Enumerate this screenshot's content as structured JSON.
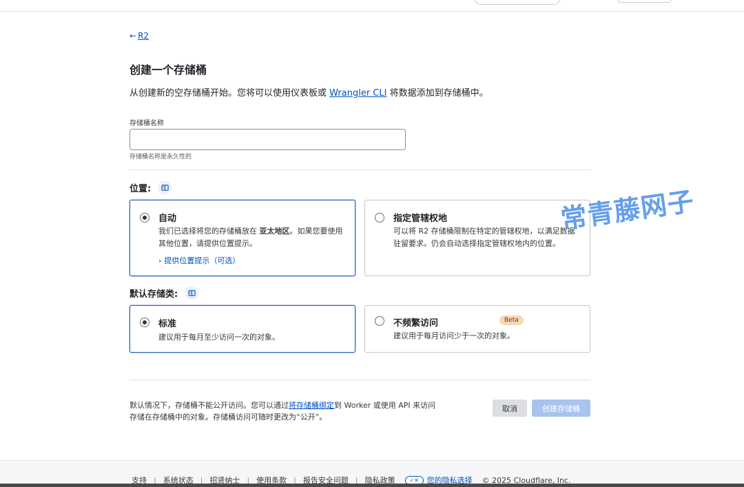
{
  "back": {
    "arrow": "←",
    "label": "R2"
  },
  "page": {
    "title": "创建一个存储桶",
    "intro_before": "从创建新的空存储桶开始。您将可以使用仪表板或 ",
    "intro_link": "Wrangler CLI",
    "intro_after": " 将数据添加到存储桶中。"
  },
  "bucket_name": {
    "label": "存储桶名称",
    "value": "",
    "placeholder": "",
    "help": "存储桶名称是永久性的"
  },
  "location": {
    "label": "位置:",
    "options": [
      {
        "title": "自动",
        "desc_before": "我们已选择将您的存储桶放在 ",
        "desc_bold": "亚太地区",
        "desc_after": "。如果您要使用其他位置，请提供位置提示。",
        "link": "提供位置提示（可选）",
        "selected": true
      },
      {
        "title": "指定管辖权地",
        "desc": "可以将 R2 存储桶限制在特定的管辖权地，以满足数据驻留要求。仍会自动选择指定管辖权地内的位置。",
        "selected": false
      }
    ]
  },
  "storage_class": {
    "label": "默认存储类:",
    "options": [
      {
        "title": "标准",
        "desc": "建议用于每月至少访问一次的对象。",
        "selected": true
      },
      {
        "title": "不频繁访问",
        "badge": "Beta",
        "desc": "建议用于每月访问少于一次的对象。",
        "selected": false
      }
    ]
  },
  "note": {
    "before": "默认情况下，存储桶不能公开访问。您可以通过",
    "link": "将存储桶绑定",
    "after": "到 Worker 或使用 API 来访问存储在存储桶中的对象。存储桶访问可随时更改为“公开”。"
  },
  "actions": {
    "cancel": "取消",
    "create": "创建存储桶"
  },
  "footer": {
    "links": [
      "支持",
      "系统状态",
      "招贤纳士",
      "使用条款",
      "报告安全问题",
      "隐私政策"
    ],
    "privacy_choice": "您的隐私选择",
    "copyright": "© 2025 Cloudflare, Inc."
  },
  "watermark": "常青藤网子",
  "colors": {
    "accent": "#0051c3",
    "selected_border": "#1f5fbf",
    "create_disabled": "#a8c3ee",
    "beta_bg": "#f7d8b4"
  },
  "icons": {
    "back": "arrow-left-icon",
    "docs": "documentation-icon",
    "link_chevron": "chevron-right-icon",
    "privacy": "privacy-toggle-icon"
  }
}
